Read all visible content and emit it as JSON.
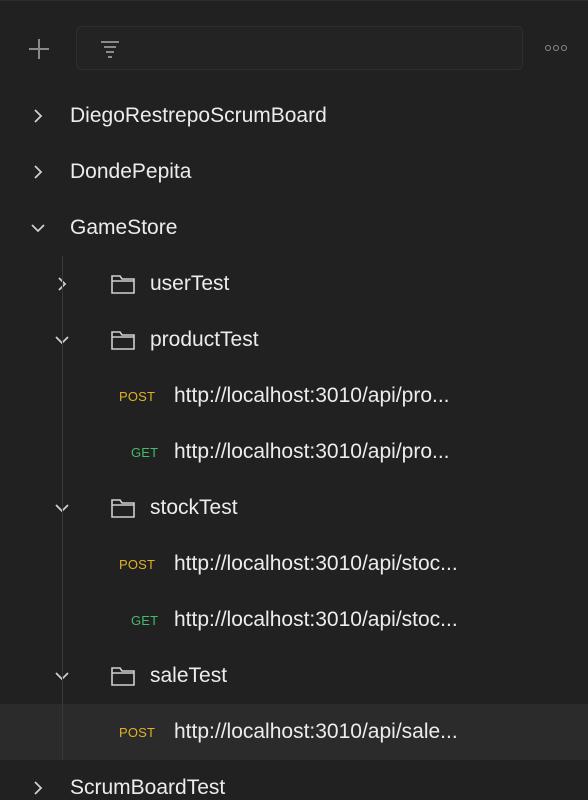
{
  "toolbar": {
    "add_icon": "plus-icon",
    "filter_icon": "filter-icon",
    "filter_placeholder": "",
    "more_icon": "more-options-icon"
  },
  "tree": {
    "collections": [
      {
        "name": "DiegoRestrepoScrumBoard",
        "expanded": false
      },
      {
        "name": "DondePepita",
        "expanded": false
      },
      {
        "name": "GameStore",
        "expanded": true,
        "folders": [
          {
            "name": "userTest",
            "expanded": false,
            "requests": []
          },
          {
            "name": "productTest",
            "expanded": true,
            "requests": [
              {
                "method": "POST",
                "url": "http://localhost:3010/api/pro..."
              },
              {
                "method": "GET",
                "url": "http://localhost:3010/api/pro..."
              }
            ]
          },
          {
            "name": "stockTest",
            "expanded": true,
            "requests": [
              {
                "method": "POST",
                "url": "http://localhost:3010/api/stoc..."
              },
              {
                "method": "GET",
                "url": "http://localhost:3010/api/stoc..."
              }
            ]
          },
          {
            "name": "saleTest",
            "expanded": true,
            "requests": [
              {
                "method": "POST",
                "url": "http://localhost:3010/api/sale...",
                "selected": true
              }
            ]
          }
        ]
      },
      {
        "name": "ScrumBoardTest",
        "expanded": false
      }
    ]
  },
  "colors": {
    "background": "#212121",
    "post": "#e3b025",
    "get": "#46b96b",
    "selected_row": "#2b2b2b"
  }
}
